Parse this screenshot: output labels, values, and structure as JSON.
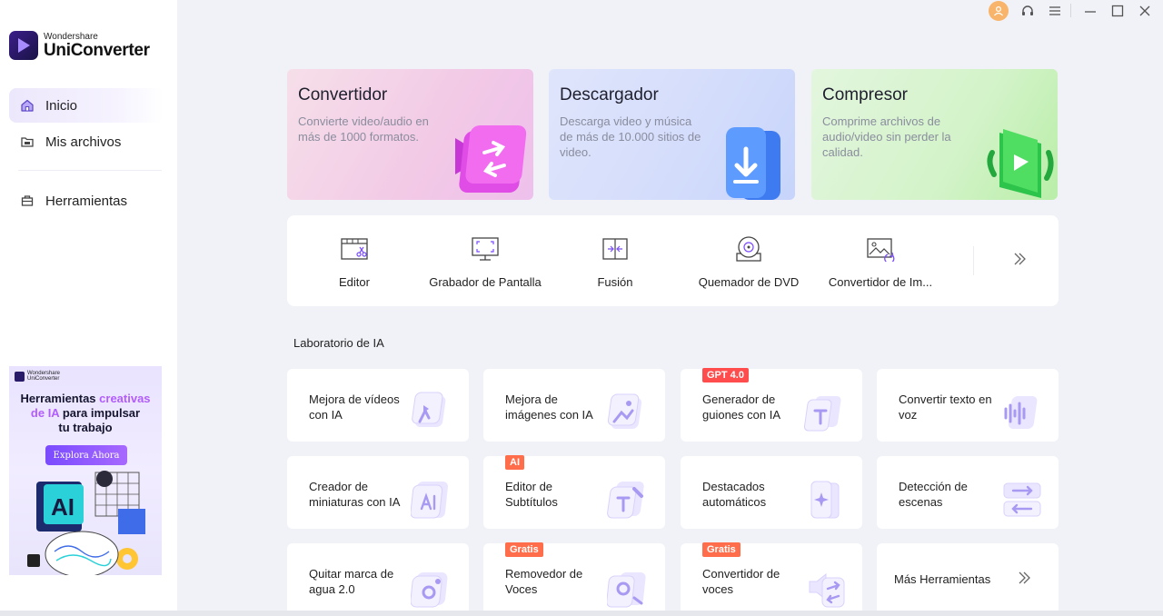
{
  "brand": {
    "small": "Wondershare",
    "name": "UniConverter"
  },
  "sidebar": {
    "items": [
      {
        "label": "Inicio",
        "icon": "home-icon"
      },
      {
        "label": "Mis archivos",
        "icon": "folder-icon"
      },
      {
        "label": "Herramientas",
        "icon": "toolbox-icon"
      }
    ]
  },
  "promo": {
    "brand_small": "Wondershare",
    "brand_name": "UniConverter",
    "title_1": "Herramientas ",
    "title_hl_1": "creativas",
    "title_hl_2": "de IA",
    "title_2": " para impulsar",
    "title_3": "tu trabajo",
    "button": "Explora Ahora",
    "art_text": "AI"
  },
  "cards": [
    {
      "title": "Convertidor",
      "desc": "Convierte video/audio en más de 1000 formatos."
    },
    {
      "title": "Descargador",
      "desc": "Descarga video y música de más de 10.000 sitios de video."
    },
    {
      "title": "Compresor",
      "desc": "Comprime archivos de audio/video sin perder la calidad."
    }
  ],
  "tools": [
    {
      "label": "Editor",
      "icon": "editor-icon"
    },
    {
      "label": "Grabador de Pantalla",
      "icon": "screen-recorder-icon"
    },
    {
      "label": "Fusión",
      "icon": "merge-icon"
    },
    {
      "label": "Quemador de DVD",
      "icon": "dvd-icon"
    },
    {
      "label": "Convertidor de Im...",
      "icon": "image-converter-icon"
    }
  ],
  "section_title": "Laboratorio de IA",
  "ai_tools": [
    {
      "label": "Mejora de vídeos con IA",
      "badge": ""
    },
    {
      "label": "Mejora de imágenes con IA",
      "badge": ""
    },
    {
      "label": "Generador de guiones con IA",
      "badge": "GPT 4.0"
    },
    {
      "label": "Convertir texto en voz",
      "badge": ""
    },
    {
      "label": "Creador de miniaturas con IA",
      "badge": ""
    },
    {
      "label": "Editor de Subtítulos",
      "badge": "AI"
    },
    {
      "label": "Destacados automáticos",
      "badge": ""
    },
    {
      "label": "Detección de escenas",
      "badge": ""
    },
    {
      "label": "Quitar marca de agua 2.0",
      "badge": ""
    },
    {
      "label": "Removedor de Voces",
      "badge": "Gratis"
    },
    {
      "label": "Convertidor de voces",
      "badge": "Gratis"
    }
  ],
  "more_tools": "Más Herramientas",
  "colors": {
    "accent": "#7a4bff",
    "badge": "#ff4c4c",
    "avatar": "#f8b46a"
  }
}
